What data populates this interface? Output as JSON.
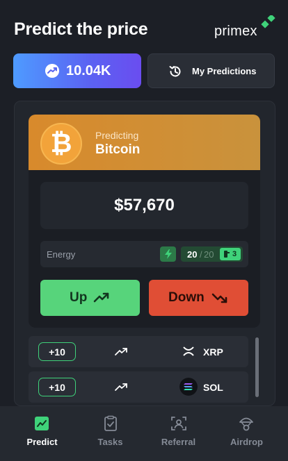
{
  "header": {
    "title": "Predict the price",
    "logo_text": "primex"
  },
  "actions": {
    "balance": "10.04K",
    "my_predictions_label": "My Predictions"
  },
  "prediction": {
    "predicting_label": "Predicting",
    "coin_name": "Bitcoin",
    "coin_symbol": "₿",
    "price": "$57,670",
    "energy": {
      "label": "Energy",
      "current": "20",
      "separator": "/",
      "max": "20",
      "boost_count": "3"
    },
    "up_label": "Up",
    "down_label": "Down"
  },
  "coin_list": [
    {
      "reward": "+10",
      "name": "XRP",
      "icon": "xrp-icon"
    },
    {
      "reward": "+10",
      "name": "SOL",
      "icon": "sol-icon"
    }
  ],
  "tabs": [
    {
      "label": "Predict",
      "icon": "chart-icon",
      "active": true
    },
    {
      "label": "Tasks",
      "icon": "tasks-icon",
      "active": false
    },
    {
      "label": "Referral",
      "icon": "referral-icon",
      "active": false
    },
    {
      "label": "Airdrop",
      "icon": "airdrop-icon",
      "active": false
    }
  ],
  "colors": {
    "accent_green": "#57d47b",
    "accent_red": "#e04e35",
    "bitcoin_orange": "#f2a33a",
    "background": "#1c1f26"
  }
}
